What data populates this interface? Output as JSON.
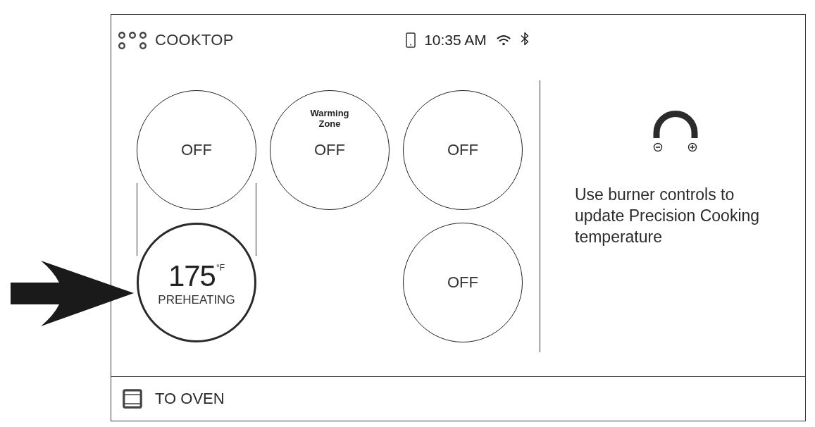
{
  "header": {
    "title": "COOKTOP",
    "time": "10:35 AM"
  },
  "columns": [
    {
      "bridged": true,
      "burners": [
        {
          "kind": "off",
          "label": "OFF",
          "selected": false
        },
        {
          "kind": "temperature",
          "temperature": "175",
          "unit": "°F",
          "status": "PREHEATING",
          "selected": true
        }
      ]
    },
    {
      "bridged": false,
      "burners": [
        {
          "kind": "off",
          "zone_label": "Warming Zone",
          "label": "OFF",
          "selected": false
        }
      ]
    },
    {
      "bridged": false,
      "burners": [
        {
          "kind": "off",
          "label": "OFF",
          "selected": false
        },
        {
          "kind": "off",
          "label": "OFF",
          "selected": false
        }
      ]
    }
  ],
  "precision_panel": {
    "hint": "Use burner controls to update Precision Cooking temperature"
  },
  "footer": {
    "button": "TO OVEN"
  }
}
